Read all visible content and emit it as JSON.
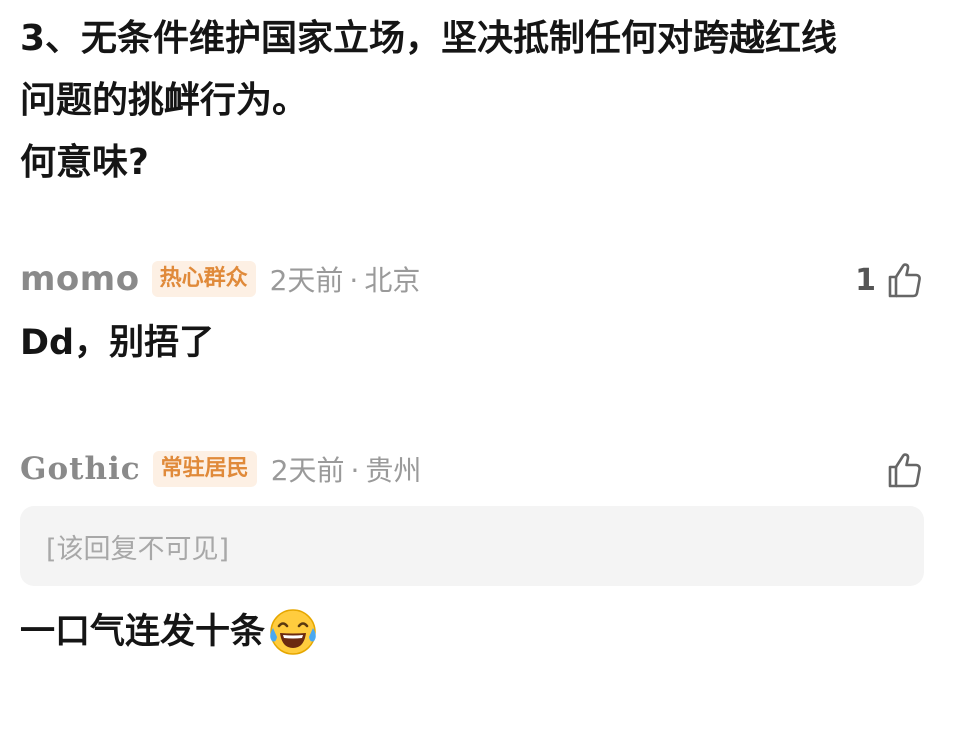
{
  "post": {
    "line1": "3、无条件维护国家立场，坚决抵制任何对跨越红线",
    "line2": "问题的挑衅行为。",
    "line3": "何意味?"
  },
  "comments": [
    {
      "username": "momo",
      "badge": "热心群众",
      "time": "2天前",
      "separator": "·",
      "location": "北京",
      "like_count": "1",
      "text": "Dd，别捂了"
    },
    {
      "username": "Gothic",
      "badge": "常驻居民",
      "time": "2天前",
      "separator": "·",
      "location": "贵州",
      "like_count": "",
      "quoted_reply": "[该回复不可见]",
      "text": "一口气连发十条"
    }
  ],
  "colors": {
    "badge_bg": "#fdf0e4",
    "badge_text": "#e08a3a",
    "meta_gray": "#9a9a9a",
    "username_gray": "#8a8a8a",
    "quote_bg": "#f4f4f4"
  },
  "icons": {
    "like": "thumbs-up-icon",
    "emoji": "tears-of-joy-emoji-icon"
  }
}
